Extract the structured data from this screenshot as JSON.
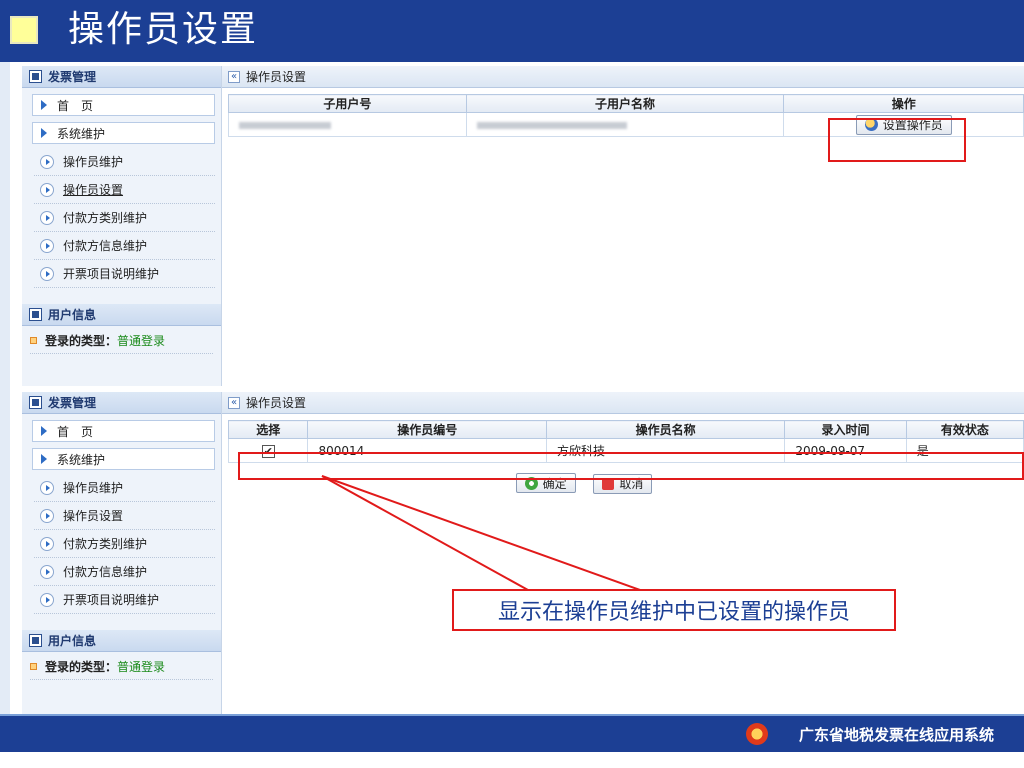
{
  "header": {
    "title": "操作员设置"
  },
  "sidebar": {
    "section_title": "发票管理",
    "nav": [
      "首　页",
      "系统维护"
    ],
    "items": [
      "操作员维护",
      "操作员设置",
      "付款方类别维护",
      "付款方信息维护",
      "开票项目说明维护"
    ],
    "user_section": "用户信息",
    "login_label": "登录的类型：",
    "login_value": "普通登录"
  },
  "top_panel": {
    "breadcrumb": "操作员设置",
    "columns": [
      "子用户号",
      "子用户名称",
      "操作"
    ],
    "action_button": "设置操作员"
  },
  "bottom_panel": {
    "breadcrumb": "操作员设置",
    "columns": [
      "选择",
      "操作员编号",
      "操作员名称",
      "录入时间",
      "有效状态"
    ],
    "row": {
      "checked": "✔",
      "id": "800014",
      "name": "方欣科技",
      "date": "2009-09-07",
      "status": "是"
    },
    "confirm_button": "确定",
    "cancel_button": "取消"
  },
  "callout": {
    "text": "显示在操作员维护中已设置的操作员"
  },
  "footer": {
    "system_name": "广东省地税发票在线应用系统"
  },
  "colors": {
    "brand_blue": "#1c3f94",
    "highlight_red": "#e11a1a",
    "accent_green": "#1a8a1a"
  }
}
